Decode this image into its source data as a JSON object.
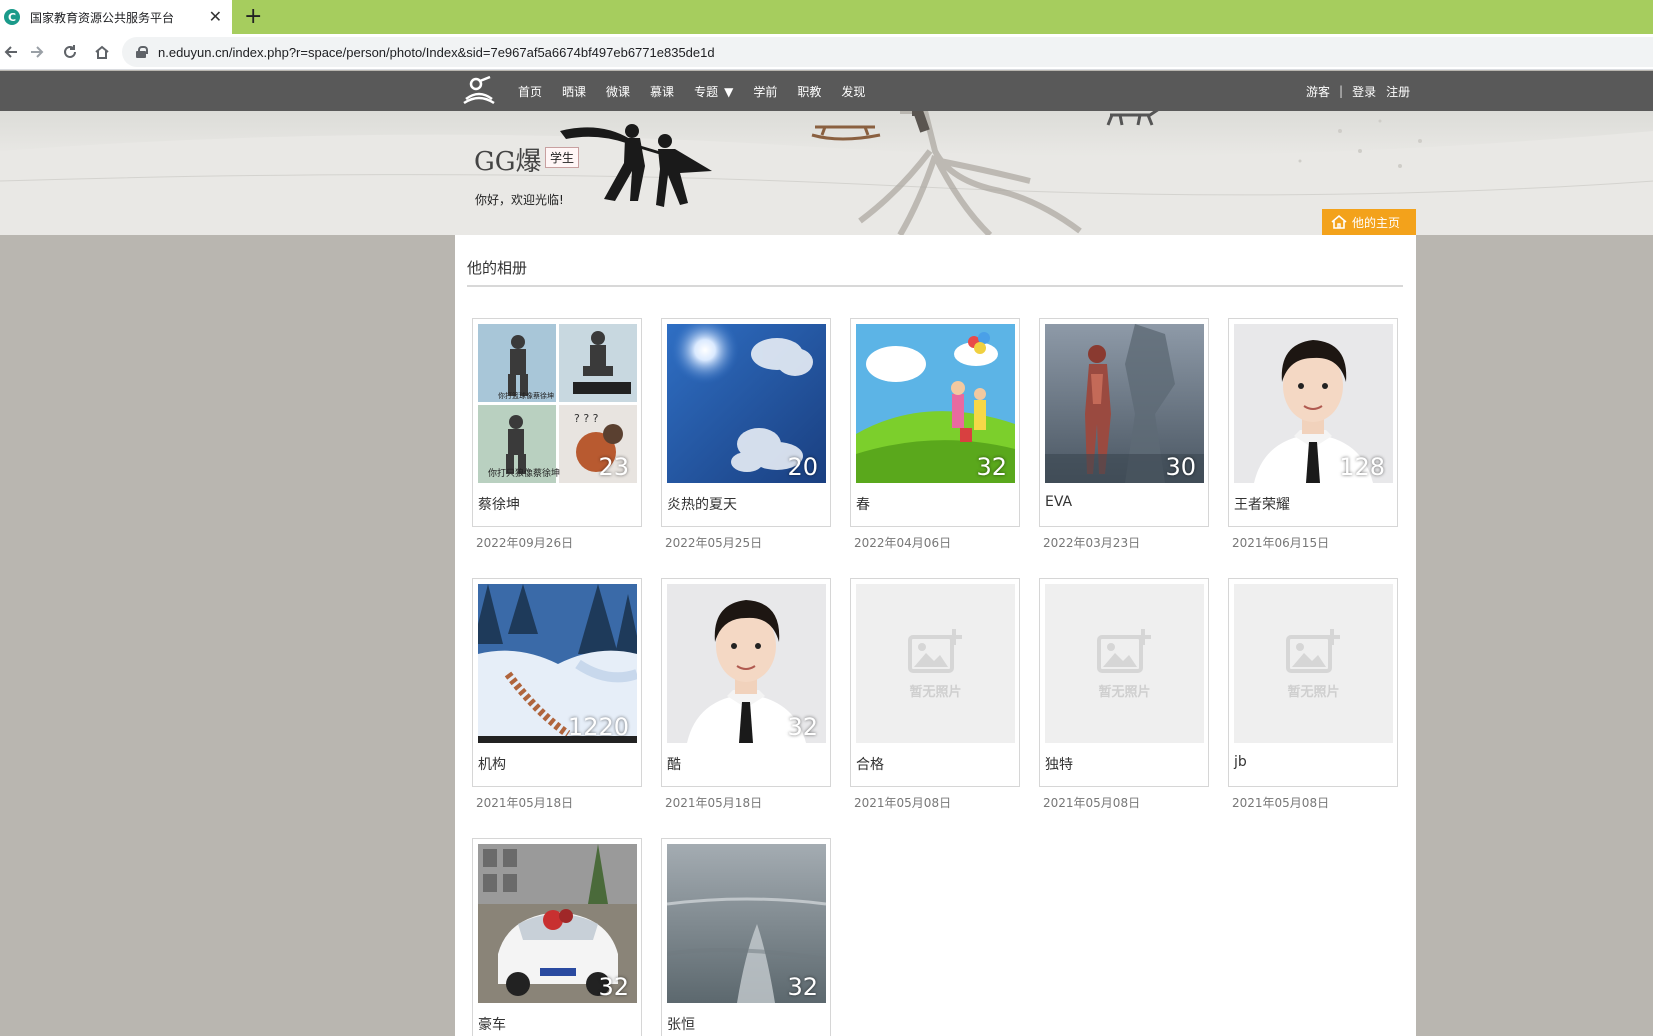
{
  "browser": {
    "tab_title": "国家教育资源公共服务平台",
    "tab_favicon": "C",
    "url": "n.eduyun.cn/index.php?r=space/person/photo/Index&sid=7e967af5a6674bf497eb6771e835de1d"
  },
  "nav": {
    "items": [
      "首页",
      "晒课",
      "微课",
      "慕课",
      "专题",
      "学前",
      "职教",
      "发现"
    ],
    "right": {
      "guest": "游客",
      "sep": "|",
      "login": "登录",
      "register": "注册"
    }
  },
  "profile": {
    "name": "GG爆",
    "role": "学生",
    "greeting": "你好，欢迎光临!",
    "home_button": "他的主页"
  },
  "section_title": "他的相册",
  "no_photo_text": "暂无照片",
  "albums": [
    {
      "name": "蔡徐坤",
      "count": "23",
      "date": "2022年09月26日",
      "thumb": "collage"
    },
    {
      "name": "炎热的夏天",
      "count": "20",
      "date": "2022年05月25日",
      "thumb": "sky"
    },
    {
      "name": "春",
      "count": "32",
      "date": "2022年04月06日",
      "thumb": "cartoon"
    },
    {
      "name": "EVA",
      "count": "30",
      "date": "2022年03月23日",
      "thumb": "robot"
    },
    {
      "name": "王者荣耀",
      "count": "128",
      "date": "2021年06月15日",
      "thumb": "portrait"
    },
    {
      "name": "机构",
      "count": "1220",
      "date": "2021年05月18日",
      "thumb": "snow"
    },
    {
      "name": "酷",
      "count": "32",
      "date": "2021年05月18日",
      "thumb": "portrait"
    },
    {
      "name": "合格",
      "count": "",
      "date": "2021年05月08日",
      "thumb": "none"
    },
    {
      "name": "独特",
      "count": "",
      "date": "2021年05月08日",
      "thumb": "none"
    },
    {
      "name": "jb",
      "count": "",
      "date": "2021年05月08日",
      "thumb": "none"
    },
    {
      "name": "豪车",
      "count": "32",
      "date": "",
      "thumb": "car"
    },
    {
      "name": "张恒",
      "count": "32",
      "date": "",
      "thumb": "sea"
    }
  ]
}
